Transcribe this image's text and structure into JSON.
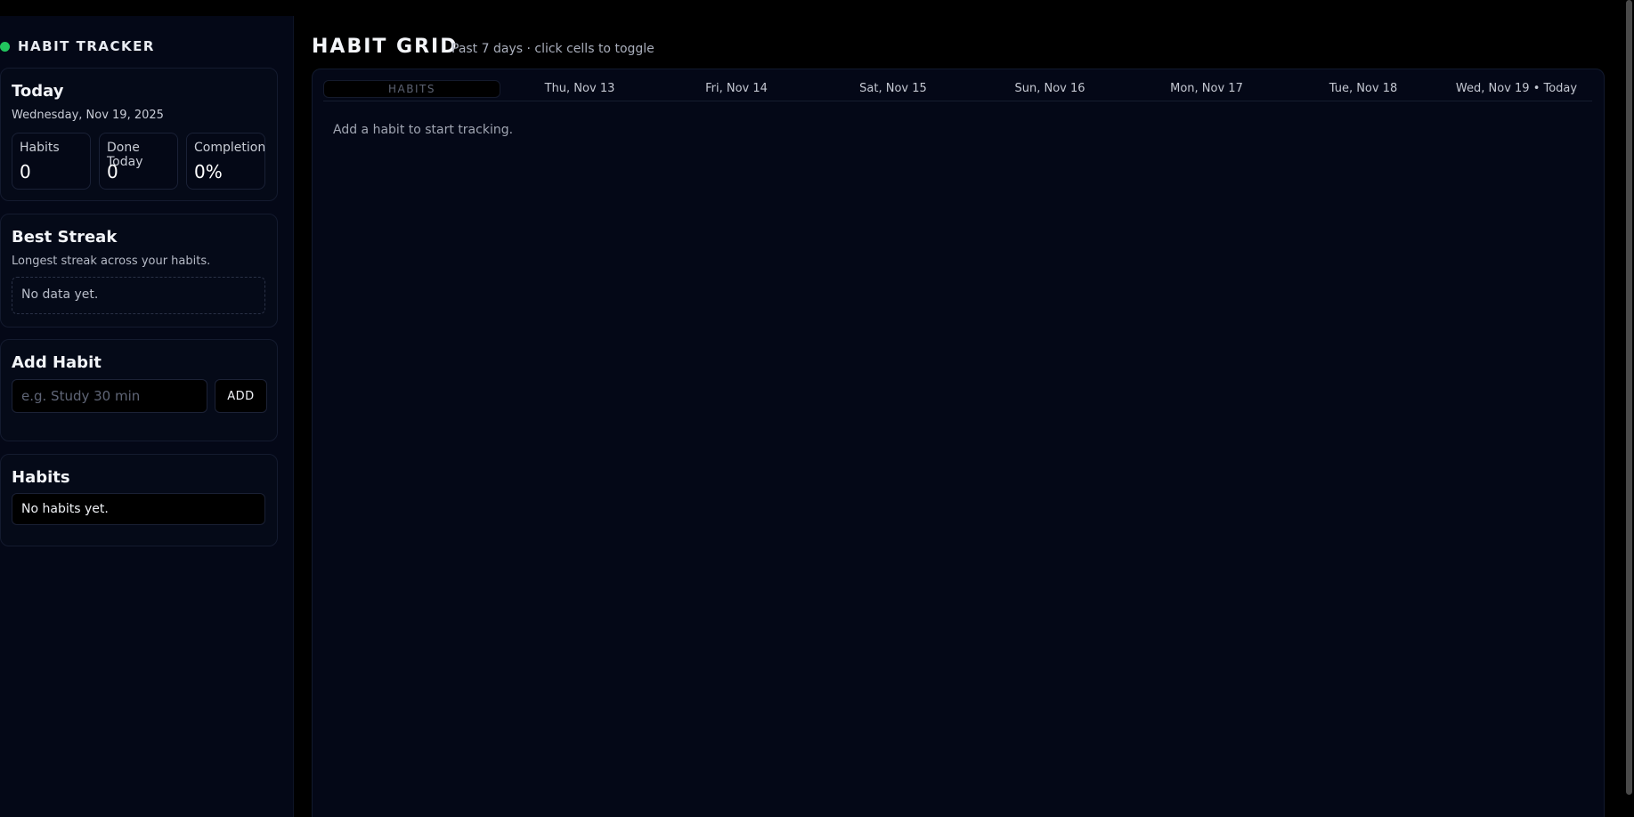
{
  "brand": {
    "title": "HABIT TRACKER",
    "status_color": "#22c55e"
  },
  "today": {
    "title": "Today",
    "date": "Wednesday, Nov 19, 2025",
    "stats": [
      {
        "label": "Habits",
        "value": "0"
      },
      {
        "label": "Done Today",
        "value": "0"
      },
      {
        "label": "Completion",
        "value": "0%"
      }
    ]
  },
  "best_streak": {
    "title": "Best Streak",
    "subtitle": "Longest streak across your habits.",
    "empty_text": "No data yet."
  },
  "add_habit": {
    "title": "Add Habit",
    "placeholder": "e.g. Study 30 min",
    "value": "",
    "button_label": "ADD"
  },
  "habits": {
    "title": "Habits",
    "empty_text": "No habits yet."
  },
  "grid": {
    "title": "HABIT GRID",
    "subtitle": "Past 7 days · click cells to toggle",
    "habits_header": "HABITS",
    "days": [
      "Thu, Nov 13",
      "Fri, Nov 14",
      "Sat, Nov 15",
      "Sun, Nov 16",
      "Mon, Nov 17",
      "Tue, Nov 18",
      "Wed, Nov 19 • Today"
    ],
    "empty_text": "Add a habit to start tracking."
  }
}
